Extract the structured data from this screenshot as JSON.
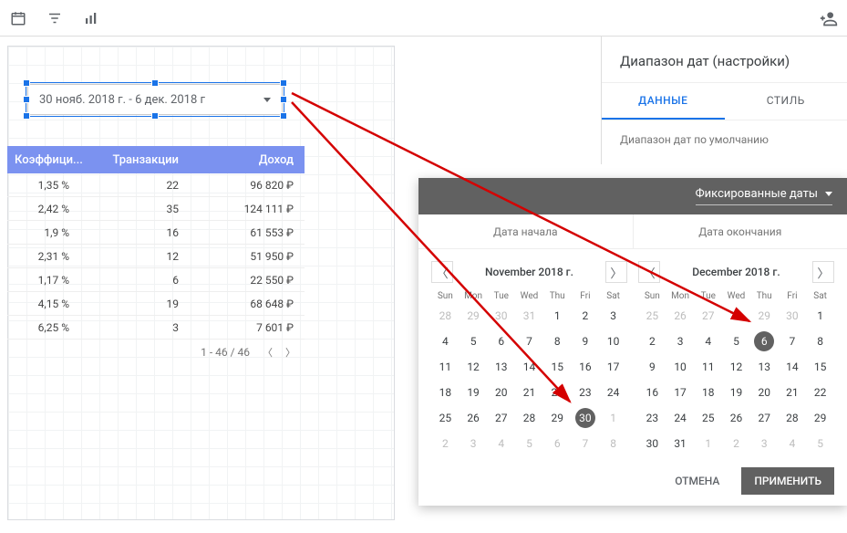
{
  "toolbar": {
    "icon_calendar": "calendar-icon",
    "icon_filter": "filter-icon",
    "icon_metrics": "metrics-icon",
    "icon_adduser": "add-user-icon"
  },
  "widget": {
    "date_range_text": "30 нояб. 2018 г. - 6 дек. 2018 г"
  },
  "table": {
    "headers": {
      "col1": "Коэффици...",
      "col2": "Транзакции",
      "col3": "Доход"
    },
    "rows": [
      {
        "c1": "1,35 %",
        "c2": "22",
        "c3": "96 820 ₽"
      },
      {
        "c1": "2,42 %",
        "c2": "35",
        "c3": "124 111 ₽"
      },
      {
        "c1": "1,9 %",
        "c2": "16",
        "c3": "61 553 ₽"
      },
      {
        "c1": "2,31 %",
        "c2": "12",
        "c3": "51 950 ₽"
      },
      {
        "c1": "1,17 %",
        "c2": "6",
        "c3": "22 550 ₽"
      },
      {
        "c1": "4,15 %",
        "c2": "19",
        "c3": "68 648 ₽"
      },
      {
        "c1": "6,25 %",
        "c2": "3",
        "c3": "7 601 ₽"
      }
    ],
    "pager_text": "1 - 46 / 46"
  },
  "panel": {
    "title": "Диапазон дат (настройки)",
    "tab_data": "ДАННЫЕ",
    "tab_style": "СТИЛЬ",
    "section_label": "Диапазон дат по умолчанию"
  },
  "datepicker": {
    "mode_label": "Фиксированные даты",
    "start_label": "Дата начала",
    "end_label": "Дата окончания",
    "cancel_label": "ОТМЕНА",
    "apply_label": "ПРИМЕНИТЬ",
    "dayhead": [
      "Sun",
      "Mon",
      "Tue",
      "Wed",
      "Thu",
      "Fri",
      "Sat"
    ],
    "cal1": {
      "title": "November 2018 г.",
      "selected": 30,
      "cells": [
        {
          "n": 28,
          "m": 1
        },
        {
          "n": 29,
          "m": 1
        },
        {
          "n": 30,
          "m": 1
        },
        {
          "n": 31,
          "m": 1
        },
        {
          "n": 1
        },
        {
          "n": 2
        },
        {
          "n": 3
        },
        {
          "n": 4
        },
        {
          "n": 5
        },
        {
          "n": 6
        },
        {
          "n": 7
        },
        {
          "n": 8
        },
        {
          "n": 9
        },
        {
          "n": 10
        },
        {
          "n": 11
        },
        {
          "n": 12
        },
        {
          "n": 13
        },
        {
          "n": 14
        },
        {
          "n": 15
        },
        {
          "n": 16
        },
        {
          "n": 17
        },
        {
          "n": 18
        },
        {
          "n": 19
        },
        {
          "n": 20
        },
        {
          "n": 21
        },
        {
          "n": 22
        },
        {
          "n": 23
        },
        {
          "n": 24
        },
        {
          "n": 25
        },
        {
          "n": 26
        },
        {
          "n": 27
        },
        {
          "n": 28
        },
        {
          "n": 29
        },
        {
          "n": 30,
          "s": 1
        },
        {
          "n": 1,
          "m": 1
        },
        {
          "n": 2,
          "m": 1
        },
        {
          "n": 3,
          "m": 1
        },
        {
          "n": 4,
          "m": 1
        },
        {
          "n": 5,
          "m": 1
        },
        {
          "n": 6,
          "m": 1
        },
        {
          "n": 7,
          "m": 1
        },
        {
          "n": 8,
          "m": 1
        }
      ]
    },
    "cal2": {
      "title": "December 2018 г.",
      "selected": 6,
      "cells": [
        {
          "n": 25,
          "m": 1
        },
        {
          "n": 26,
          "m": 1
        },
        {
          "n": 27,
          "m": 1
        },
        {
          "n": 28,
          "m": 1
        },
        {
          "n": 29,
          "m": 1
        },
        {
          "n": 30,
          "m": 1
        },
        {
          "n": 1
        },
        {
          "n": 2
        },
        {
          "n": 3
        },
        {
          "n": 4
        },
        {
          "n": 5
        },
        {
          "n": 6,
          "s": 1
        },
        {
          "n": 7
        },
        {
          "n": 8
        },
        {
          "n": 9
        },
        {
          "n": 10
        },
        {
          "n": 11
        },
        {
          "n": 12
        },
        {
          "n": 13
        },
        {
          "n": 14
        },
        {
          "n": 15
        },
        {
          "n": 16
        },
        {
          "n": 17
        },
        {
          "n": 18
        },
        {
          "n": 19
        },
        {
          "n": 20
        },
        {
          "n": 21
        },
        {
          "n": 22
        },
        {
          "n": 23
        },
        {
          "n": 24
        },
        {
          "n": 25
        },
        {
          "n": 26
        },
        {
          "n": 27
        },
        {
          "n": 28
        },
        {
          "n": 29
        },
        {
          "n": 30
        },
        {
          "n": 31
        },
        {
          "n": 1,
          "m": 1
        },
        {
          "n": 2,
          "m": 1
        },
        {
          "n": 3,
          "m": 1
        },
        {
          "n": 4,
          "m": 1
        },
        {
          "n": 5,
          "m": 1
        }
      ]
    }
  }
}
